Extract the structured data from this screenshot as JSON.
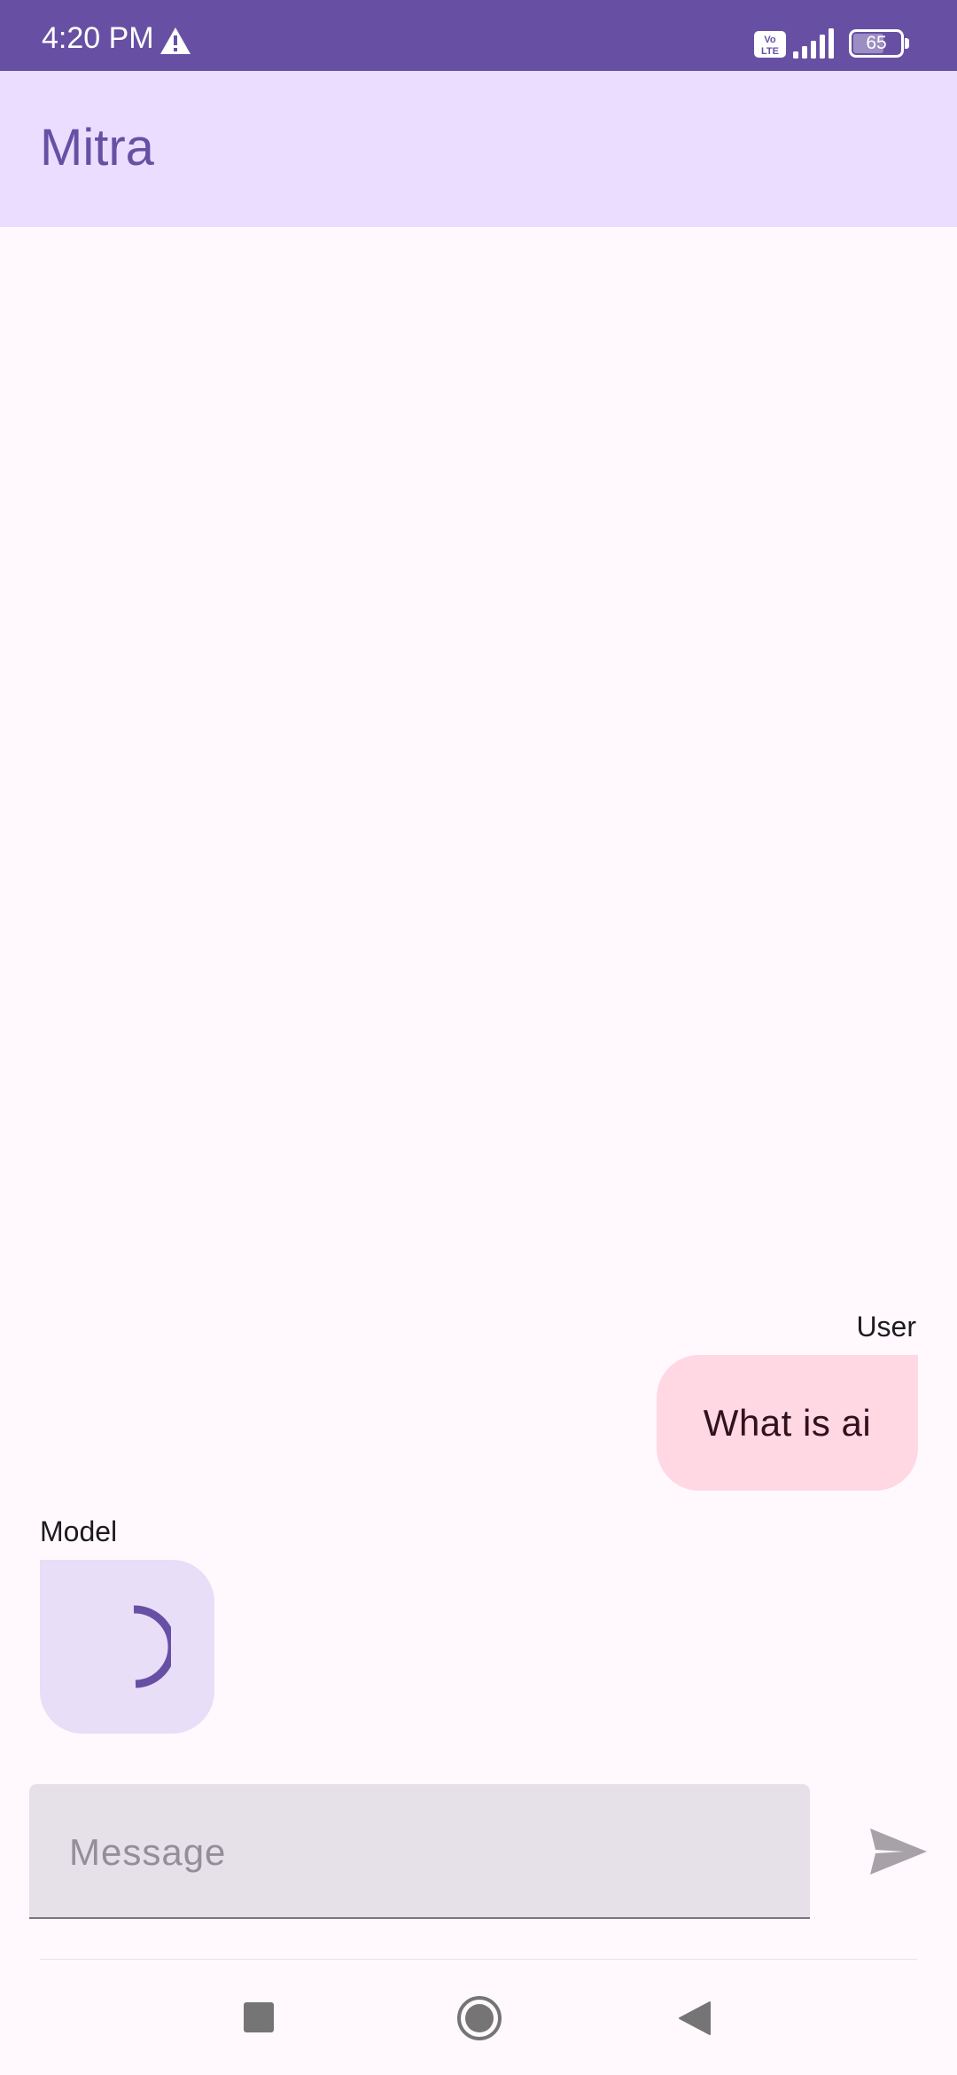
{
  "status_bar": {
    "time": "4:20 PM",
    "battery_level": "65",
    "icons": [
      "warning-icon",
      "volte-icon",
      "signal-icon",
      "battery-icon"
    ]
  },
  "app_bar": {
    "title": "Mitra"
  },
  "chat": {
    "messages": [
      {
        "sender": "User",
        "text": "What is ai"
      },
      {
        "sender": "Model",
        "text": "",
        "loading": true
      }
    ]
  },
  "composer": {
    "placeholder": "Message",
    "value": "",
    "send_icon": "send-icon"
  },
  "nav_bar": {
    "icons": [
      "recents-icon",
      "home-icon",
      "back-icon"
    ]
  },
  "colors": {
    "primary": "#6750A4",
    "app_bar_bg": "#EADDFF",
    "user_bubble": "#FFD8E4",
    "model_bubble": "#E8DEF8",
    "input_bg": "#E6E0E9",
    "background": "#FFF9FE"
  }
}
